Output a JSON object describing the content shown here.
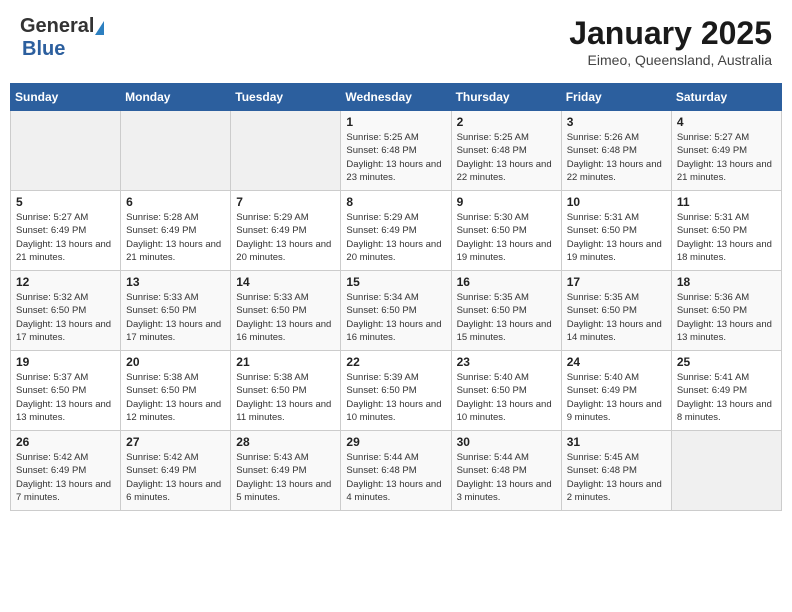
{
  "header": {
    "logo_general": "General",
    "logo_blue": "Blue",
    "month": "January 2025",
    "location": "Eimeo, Queensland, Australia"
  },
  "weekdays": [
    "Sunday",
    "Monday",
    "Tuesday",
    "Wednesday",
    "Thursday",
    "Friday",
    "Saturday"
  ],
  "weeks": [
    [
      {
        "day": "",
        "sunrise": "",
        "sunset": "",
        "daylight": ""
      },
      {
        "day": "",
        "sunrise": "",
        "sunset": "",
        "daylight": ""
      },
      {
        "day": "",
        "sunrise": "",
        "sunset": "",
        "daylight": ""
      },
      {
        "day": "1",
        "sunrise": "5:25 AM",
        "sunset": "6:48 PM",
        "daylight": "13 hours and 23 minutes."
      },
      {
        "day": "2",
        "sunrise": "5:25 AM",
        "sunset": "6:48 PM",
        "daylight": "13 hours and 22 minutes."
      },
      {
        "day": "3",
        "sunrise": "5:26 AM",
        "sunset": "6:48 PM",
        "daylight": "13 hours and 22 minutes."
      },
      {
        "day": "4",
        "sunrise": "5:27 AM",
        "sunset": "6:49 PM",
        "daylight": "13 hours and 21 minutes."
      }
    ],
    [
      {
        "day": "5",
        "sunrise": "5:27 AM",
        "sunset": "6:49 PM",
        "daylight": "13 hours and 21 minutes."
      },
      {
        "day": "6",
        "sunrise": "5:28 AM",
        "sunset": "6:49 PM",
        "daylight": "13 hours and 21 minutes."
      },
      {
        "day": "7",
        "sunrise": "5:29 AM",
        "sunset": "6:49 PM",
        "daylight": "13 hours and 20 minutes."
      },
      {
        "day": "8",
        "sunrise": "5:29 AM",
        "sunset": "6:49 PM",
        "daylight": "13 hours and 20 minutes."
      },
      {
        "day": "9",
        "sunrise": "5:30 AM",
        "sunset": "6:50 PM",
        "daylight": "13 hours and 19 minutes."
      },
      {
        "day": "10",
        "sunrise": "5:31 AM",
        "sunset": "6:50 PM",
        "daylight": "13 hours and 19 minutes."
      },
      {
        "day": "11",
        "sunrise": "5:31 AM",
        "sunset": "6:50 PM",
        "daylight": "13 hours and 18 minutes."
      }
    ],
    [
      {
        "day": "12",
        "sunrise": "5:32 AM",
        "sunset": "6:50 PM",
        "daylight": "13 hours and 17 minutes."
      },
      {
        "day": "13",
        "sunrise": "5:33 AM",
        "sunset": "6:50 PM",
        "daylight": "13 hours and 17 minutes."
      },
      {
        "day": "14",
        "sunrise": "5:33 AM",
        "sunset": "6:50 PM",
        "daylight": "13 hours and 16 minutes."
      },
      {
        "day": "15",
        "sunrise": "5:34 AM",
        "sunset": "6:50 PM",
        "daylight": "13 hours and 16 minutes."
      },
      {
        "day": "16",
        "sunrise": "5:35 AM",
        "sunset": "6:50 PM",
        "daylight": "13 hours and 15 minutes."
      },
      {
        "day": "17",
        "sunrise": "5:35 AM",
        "sunset": "6:50 PM",
        "daylight": "13 hours and 14 minutes."
      },
      {
        "day": "18",
        "sunrise": "5:36 AM",
        "sunset": "6:50 PM",
        "daylight": "13 hours and 13 minutes."
      }
    ],
    [
      {
        "day": "19",
        "sunrise": "5:37 AM",
        "sunset": "6:50 PM",
        "daylight": "13 hours and 13 minutes."
      },
      {
        "day": "20",
        "sunrise": "5:38 AM",
        "sunset": "6:50 PM",
        "daylight": "13 hours and 12 minutes."
      },
      {
        "day": "21",
        "sunrise": "5:38 AM",
        "sunset": "6:50 PM",
        "daylight": "13 hours and 11 minutes."
      },
      {
        "day": "22",
        "sunrise": "5:39 AM",
        "sunset": "6:50 PM",
        "daylight": "13 hours and 10 minutes."
      },
      {
        "day": "23",
        "sunrise": "5:40 AM",
        "sunset": "6:50 PM",
        "daylight": "13 hours and 10 minutes."
      },
      {
        "day": "24",
        "sunrise": "5:40 AM",
        "sunset": "6:49 PM",
        "daylight": "13 hours and 9 minutes."
      },
      {
        "day": "25",
        "sunrise": "5:41 AM",
        "sunset": "6:49 PM",
        "daylight": "13 hours and 8 minutes."
      }
    ],
    [
      {
        "day": "26",
        "sunrise": "5:42 AM",
        "sunset": "6:49 PM",
        "daylight": "13 hours and 7 minutes."
      },
      {
        "day": "27",
        "sunrise": "5:42 AM",
        "sunset": "6:49 PM",
        "daylight": "13 hours and 6 minutes."
      },
      {
        "day": "28",
        "sunrise": "5:43 AM",
        "sunset": "6:49 PM",
        "daylight": "13 hours and 5 minutes."
      },
      {
        "day": "29",
        "sunrise": "5:44 AM",
        "sunset": "6:48 PM",
        "daylight": "13 hours and 4 minutes."
      },
      {
        "day": "30",
        "sunrise": "5:44 AM",
        "sunset": "6:48 PM",
        "daylight": "13 hours and 3 minutes."
      },
      {
        "day": "31",
        "sunrise": "5:45 AM",
        "sunset": "6:48 PM",
        "daylight": "13 hours and 2 minutes."
      },
      {
        "day": "",
        "sunrise": "",
        "sunset": "",
        "daylight": ""
      }
    ]
  ],
  "labels": {
    "sunrise_prefix": "Sunrise: ",
    "sunset_prefix": "Sunset: ",
    "daylight_label": "Daylight: "
  }
}
